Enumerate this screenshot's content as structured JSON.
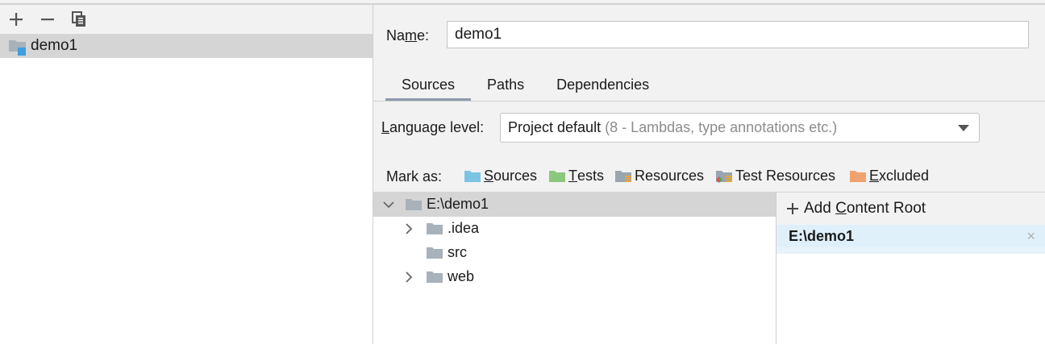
{
  "toolbar": {
    "add_icon": "plus-icon",
    "remove_icon": "minus-icon",
    "copy_icon": "copy-icon"
  },
  "modules": [
    {
      "label": "demo1",
      "icon": "module-folder-icon"
    }
  ],
  "name_field": {
    "label_prefix": "Na",
    "label_mnemonic": "m",
    "label_suffix": "e:",
    "value": "demo1"
  },
  "tabs": [
    {
      "label": "Sources",
      "active": true
    },
    {
      "label": "Paths",
      "active": false
    },
    {
      "label": "Dependencies",
      "active": false
    }
  ],
  "language_level": {
    "label_mnemonic": "L",
    "label_rest": "anguage level:",
    "selected": "Project default",
    "hint": "(8 - Lambdas, type annotations etc.)"
  },
  "mark_as": {
    "label": "Mark as:",
    "items": [
      {
        "mnemonic": "S",
        "rest": "ources",
        "color": "#7cc4e3"
      },
      {
        "mnemonic": "T",
        "rest": "ests",
        "color": "#8bc87d"
      },
      {
        "mnemonic": "",
        "rest": "Resources",
        "color": "#9aa4ae"
      },
      {
        "mnemonic": "",
        "rest": "Test Resources",
        "color": "#9aa4ae"
      },
      {
        "mnemonic": "E",
        "rest": "xcluded",
        "color": "#f0a26e"
      }
    ]
  },
  "tree": [
    {
      "label": "E:\\demo1",
      "expanded": true,
      "selected": true
    },
    {
      "label": ".idea",
      "expandable": true
    },
    {
      "label": "src",
      "expandable": false
    },
    {
      "label": "web",
      "expandable": true
    }
  ],
  "content_roots": {
    "add_prefix": "Add ",
    "add_mnemonic": "C",
    "add_suffix": "ontent Root",
    "items": [
      {
        "path": "E:\\demo1",
        "remove": "×"
      }
    ]
  },
  "colors": {
    "folder_gray": "#a9b1b9",
    "selection": "#d5d5d5",
    "root_selection": "#dff0fb",
    "tab_underline": "#8d9aae"
  }
}
